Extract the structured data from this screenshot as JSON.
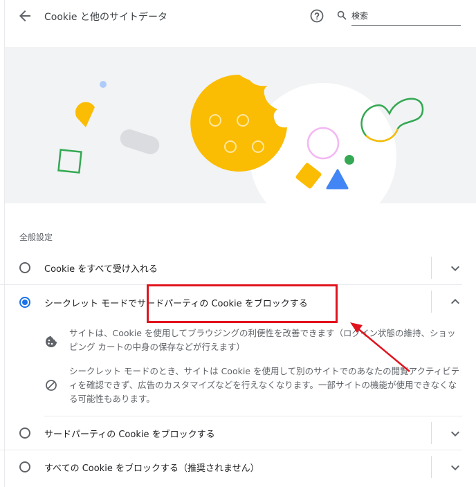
{
  "header": {
    "back_icon": "arrow-back-icon",
    "title": "Cookie と他のサイトデータ",
    "help_icon": "help-circle-icon",
    "search": {
      "icon": "search-icon",
      "placeholder": "検索",
      "value": ""
    }
  },
  "illustration": {
    "description_icon": "cookie-illustration"
  },
  "general_settings": {
    "section_label": "全般設定",
    "options": [
      {
        "label": "Cookie をすべて受け入れる",
        "selected": false,
        "expanded": false
      },
      {
        "label": "シークレット モードでサードパーティの Cookie をブロックする",
        "selected": true,
        "expanded": true,
        "details": [
          {
            "icon": "cookie-icon",
            "text": "サイトは、Cookie を使用してブラウジングの利便性を改善できます（ログイン状態の維持、ショッピング カートの中身の保存などが行えます）"
          },
          {
            "icon": "block-icon",
            "text": "シークレット モードのとき、サイトは Cookie を使用して別のサイトでのあなたの閲覧アクティビティを確認できず、広告のカスタマイズなどを行えなくなります。一部サイトの機能が使用できなくなる可能性もあります。"
          }
        ]
      },
      {
        "label": "サードパーティの Cookie をブロックする",
        "selected": false,
        "expanded": false
      },
      {
        "label": "すべての Cookie をブロックする（推奨されません）",
        "selected": false,
        "expanded": false
      }
    ]
  },
  "annotation": {
    "highlight_color": "#e0141e",
    "arrow_color": "#e0141e"
  },
  "colors": {
    "accent": "#1a73e8",
    "cookie": "#fbbc04",
    "green": "#34a853",
    "blue": "#4285f4",
    "pink": "#f3b8f3"
  }
}
